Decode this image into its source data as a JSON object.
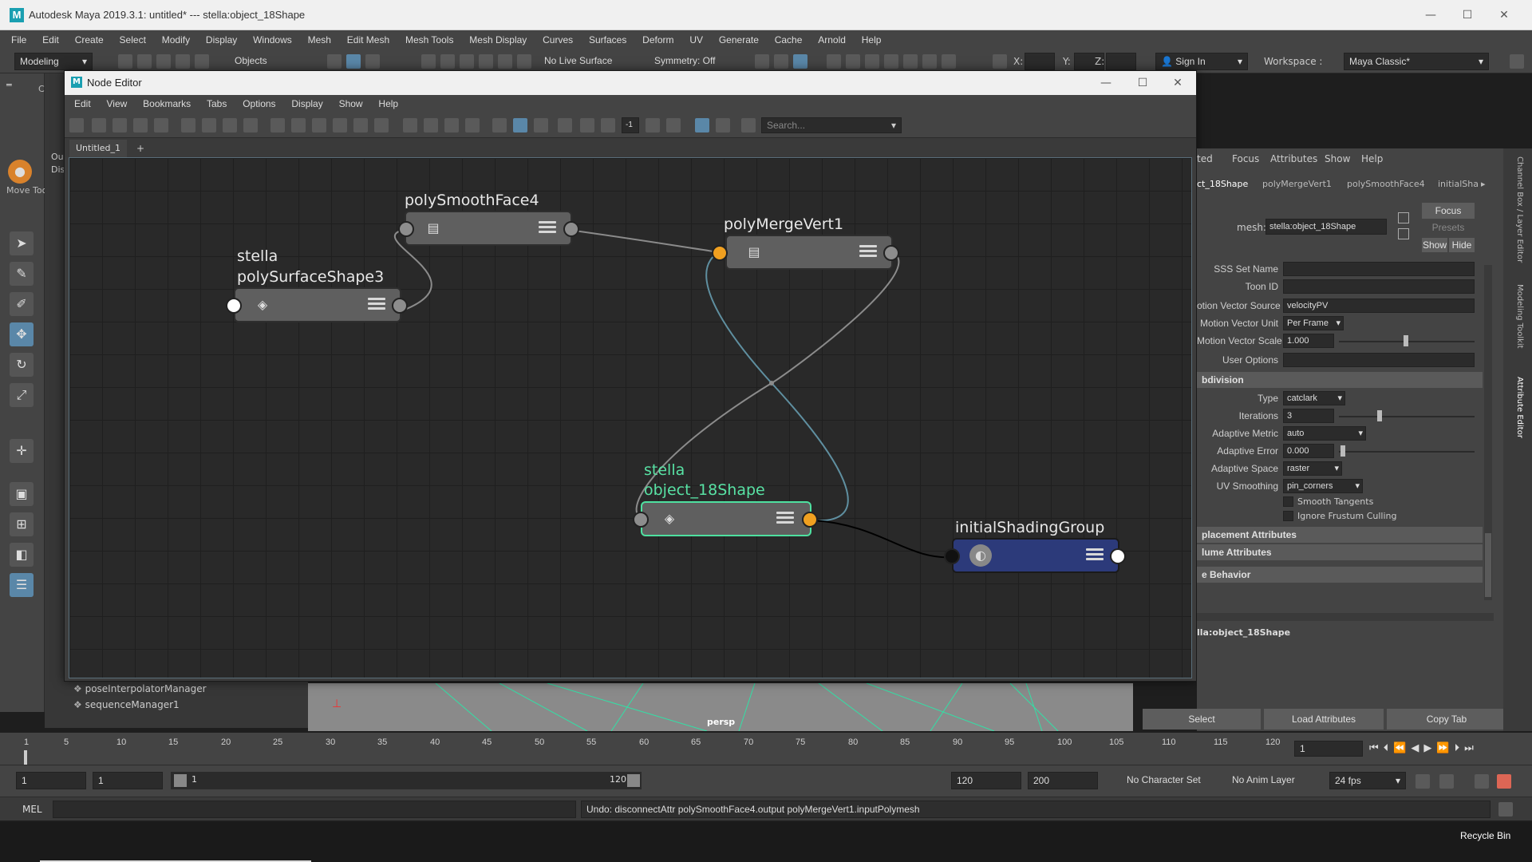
{
  "window": {
    "title": "Autodesk Maya 2019.3.1: untitled*   ---   stella:object_18Shape",
    "minimize": "—",
    "maximize": "☐",
    "close": "✕"
  },
  "menubar": [
    "File",
    "Edit",
    "Create",
    "Select",
    "Modify",
    "Display",
    "Windows",
    "Mesh",
    "Edit Mesh",
    "Mesh Tools",
    "Mesh Display",
    "Curves",
    "Surfaces",
    "Deform",
    "UV",
    "Generate",
    "Cache",
    "Arnold",
    "Help"
  ],
  "statusline": {
    "mode": "Modeling",
    "objects": "Objects",
    "live_surface": "No Live Surface",
    "symmetry": "Symmetry: Off",
    "x_label": "X:",
    "y_label": "Y:",
    "z_label": "Z:",
    "sign_in": "Sign In",
    "workspace_label": "Workspace :",
    "workspace_value": "Maya Classic*"
  },
  "toolbox": {
    "move_tool_label": "Move Tool",
    "tab_out": "Ou",
    "tab_dis": "Dis",
    "tab_curv": "Curv"
  },
  "outliner": {
    "items": [
      "poseInterpolatorManager",
      "sequenceManager1"
    ]
  },
  "viewport": {
    "label": "persp"
  },
  "node_editor": {
    "title": "Node Editor",
    "menu": [
      "Edit",
      "View",
      "Bookmarks",
      "Tabs",
      "Options",
      "Display",
      "Show",
      "Help"
    ],
    "search_placeholder": "Search...",
    "tab": "Untitled_1",
    "add_tab": "+",
    "minus_one": "-1",
    "nodes": {
      "polySmoothFace": {
        "title": "polySmoothFace4"
      },
      "polyMergeVert": {
        "title": "polyMergeVert1"
      },
      "polySurfaceShape": {
        "title1": "stella",
        "title2": "polySurfaceShape3"
      },
      "object18Shape": {
        "title1": "stella",
        "title2": "object_18Shape"
      },
      "shadingGroup": {
        "title": "initialShadingGroup"
      }
    }
  },
  "attribute_editor": {
    "menu": [
      "ted",
      "Focus",
      "Attributes",
      "Show",
      "Help"
    ],
    "tabs": [
      "ct_18Shape",
      "polyMergeVert1",
      "polySmoothFace4",
      "initialSha"
    ],
    "mesh_label": "mesh:",
    "mesh_value": "stella:object_18Shape",
    "focus_btn": "Focus",
    "presets_btn": "Presets",
    "show_btn": "Show",
    "hide_btn": "Hide",
    "rows": [
      {
        "label": "SSS Set Name",
        "value": ""
      },
      {
        "label": "Toon ID",
        "value": ""
      },
      {
        "label": "otion Vector Source",
        "value": "velocityPV"
      },
      {
        "label": "Motion Vector Unit",
        "value": "Per Frame"
      },
      {
        "label": "Motion Vector Scale",
        "value": "1.000"
      },
      {
        "label": "User Options",
        "value": ""
      }
    ],
    "subdivision_section": "bdivision",
    "subdiv_rows": [
      {
        "label": "Type",
        "value": "catclark"
      },
      {
        "label": "Iterations",
        "value": "3"
      },
      {
        "label": "Adaptive Metric",
        "value": "auto"
      },
      {
        "label": "Adaptive Error",
        "value": "0.000"
      },
      {
        "label": "Adaptive Space",
        "value": "raster"
      },
      {
        "label": "UV Smoothing",
        "value": "pin_corners"
      }
    ],
    "checkboxes": [
      "Smooth Tangents",
      "Ignore Frustum Culling"
    ],
    "sections": [
      "placement Attributes",
      "lume Attributes",
      "e Behavior"
    ],
    "node_footer": "lla:object_18Shape",
    "select_btn": "Select",
    "load_btn": "Load Attributes",
    "copy_btn": "Copy Tab"
  },
  "right_side_tabs": [
    "Channel Box / Layer Editor",
    "Modeling Toolkit",
    "Attribute Editor"
  ],
  "timeline": {
    "ticks": [
      "1",
      "5",
      "10",
      "15",
      "20",
      "25",
      "30",
      "35",
      "40",
      "45",
      "50",
      "55",
      "60",
      "65",
      "70",
      "75",
      "80",
      "85",
      "90",
      "95",
      "100",
      "105",
      "110",
      "115",
      "120"
    ],
    "current_frame": "1"
  },
  "rangebar": {
    "start": "1",
    "start2": "1",
    "range_start": "1",
    "range_end": "120",
    "end": "120",
    "end2": "200",
    "char_set": "No Character Set",
    "anim_layer": "No Anim Layer",
    "fps": "24 fps"
  },
  "cmdline": {
    "lang": "MEL",
    "feedback": "Undo: disconnectAttr polySmoothFace4.output polyMergeVert1.inputPolymesh"
  },
  "taskbar": {
    "recycle_bin": "Recycle Bin"
  }
}
